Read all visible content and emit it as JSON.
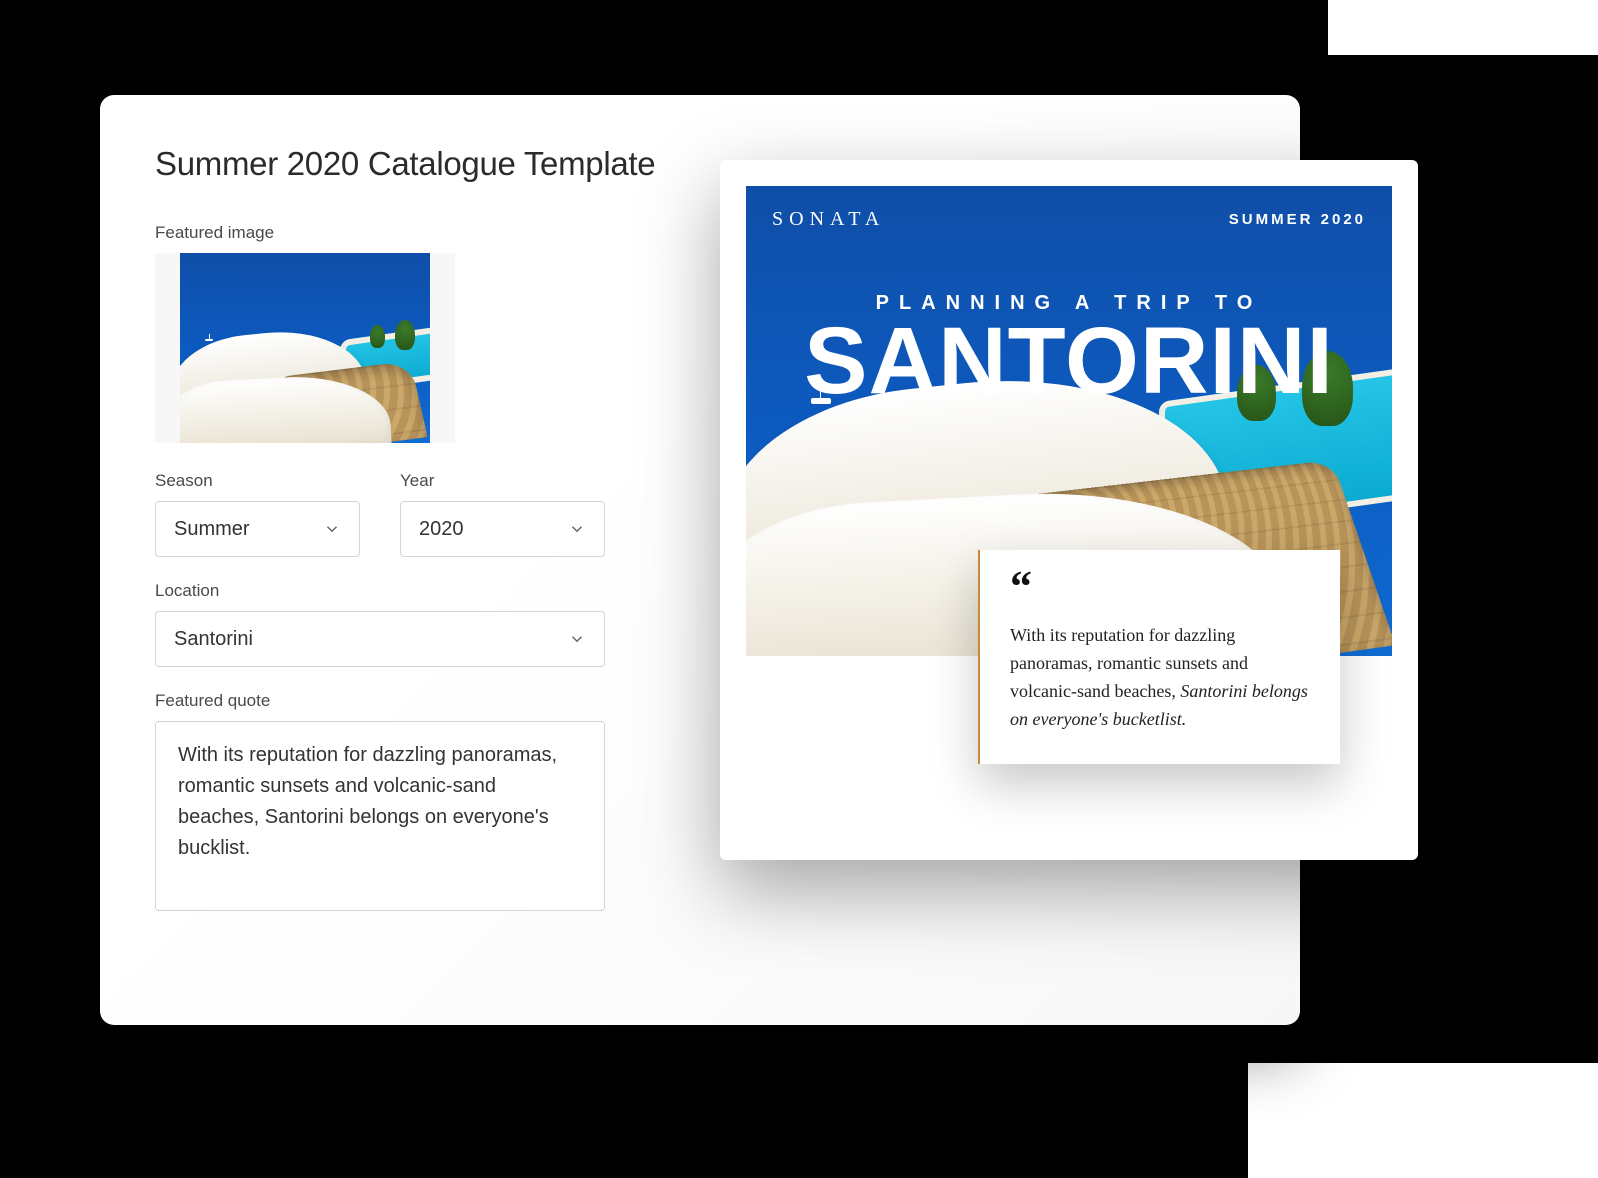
{
  "page": {
    "title": "Summer 2020 Catalogue Template"
  },
  "form": {
    "featured_image_label": "Featured image",
    "season": {
      "label": "Season",
      "value": "Summer"
    },
    "year": {
      "label": "Year",
      "value": "2020"
    },
    "location": {
      "label": "Location",
      "value": "Santorini"
    },
    "quote": {
      "label": "Featured quote",
      "value": "With its reputation for dazzling panoramas, romantic sunsets and volcanic-sand beaches, Santorini belongs on everyone's bucklist."
    }
  },
  "preview": {
    "brand": "SONATA",
    "season_tag": "SUMMER 2020",
    "subheading": "PLANNING A TRIP TO",
    "headline": "SANTORINI",
    "quote_plain": "With its reputation for dazzling panoramas, romantic sunsets and volcanic-sand beaches, ",
    "quote_emphasis": "Santorini belongs on everyone's bucketlist."
  }
}
